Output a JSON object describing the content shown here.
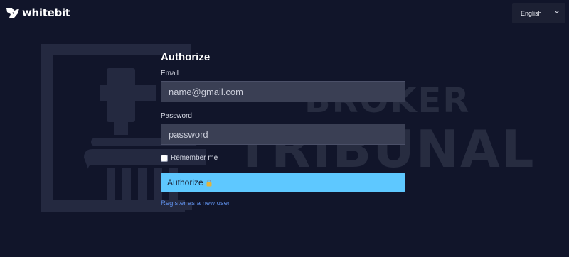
{
  "header": {
    "brand": "whitebit",
    "language_label": "English"
  },
  "watermark": {
    "line1": "BROKER",
    "line2": "TRIBUNAL"
  },
  "form": {
    "title": "Authorize",
    "email_label": "Email",
    "email_placeholder": "name@gmail.com",
    "password_label": "Password",
    "password_placeholder": "password",
    "remember_label": "Remember me",
    "remember_checked": false,
    "submit_label": "Authorize",
    "register_link": "Register as a new user"
  },
  "icons": {
    "brand": "whitebit-logo-icon",
    "language": "chevron-down-icon",
    "submit": "lock-icon"
  },
  "colors": {
    "background": "#11152a",
    "input_background": "#3a3f54",
    "button": "#5ec8ff",
    "link": "#5e8ee8",
    "watermark": "#272c40"
  }
}
